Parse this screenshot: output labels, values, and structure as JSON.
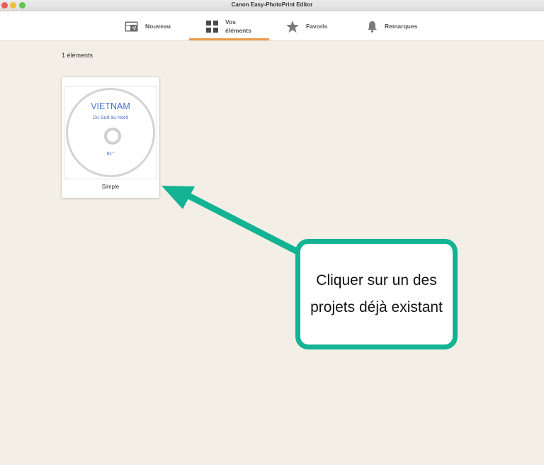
{
  "window": {
    "title": "Canon Easy-PhotoPrint Editor"
  },
  "toolbar": {
    "tabs": [
      {
        "label": "Nouveau",
        "icon": "new-document-icon"
      },
      {
        "label": "Vos éléments",
        "icon": "grid-icon",
        "active": true
      },
      {
        "label": "Favoris",
        "icon": "star-icon"
      },
      {
        "label": "Remarques",
        "icon": "bell-icon"
      }
    ],
    "active_color": "#ec9a4a"
  },
  "main": {
    "count_label": "1 éléments",
    "projects": [
      {
        "label": "Simple",
        "disc_title": "VIETNAM",
        "disc_subtitle": "Du Sud au Nord",
        "disc_number": "81°"
      }
    ]
  },
  "annotation": {
    "text": "Cliquer sur un des projets déjà existant",
    "color": "#13b393"
  }
}
